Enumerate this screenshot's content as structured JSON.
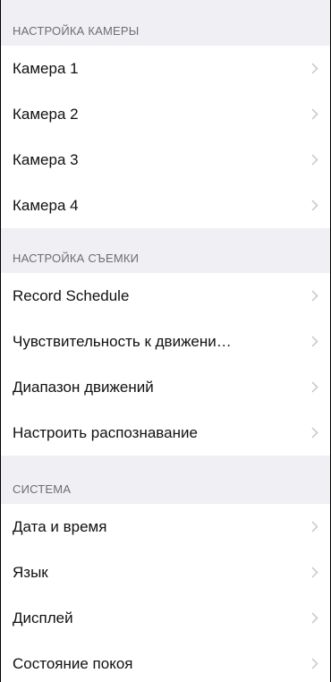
{
  "sections": [
    {
      "header": "НАСТРОЙКА КАМЕРЫ",
      "items": [
        {
          "label": "Камера 1"
        },
        {
          "label": "Камера 2"
        },
        {
          "label": "Камера 3"
        },
        {
          "label": "Камера 4"
        }
      ]
    },
    {
      "header": "НАСТРОЙКА СЪЕМКИ",
      "items": [
        {
          "label": "Record Schedule"
        },
        {
          "label": "Чувствительность к движени…"
        },
        {
          "label": "Диапазон движений"
        },
        {
          "label": "Настроить распознавание"
        }
      ]
    },
    {
      "header": "СИСТЕМА",
      "items": [
        {
          "label": "Дата и время"
        },
        {
          "label": "Язык"
        },
        {
          "label": "Дисплей"
        },
        {
          "label": "Состояние покоя"
        }
      ]
    }
  ],
  "icons": {
    "row_chevron": "chevron-right-icon"
  },
  "colors": {
    "section_background": "#efeff4",
    "section_text": "#6d6d72",
    "chevron": "#c7c7cc",
    "row_text": "#111111"
  }
}
